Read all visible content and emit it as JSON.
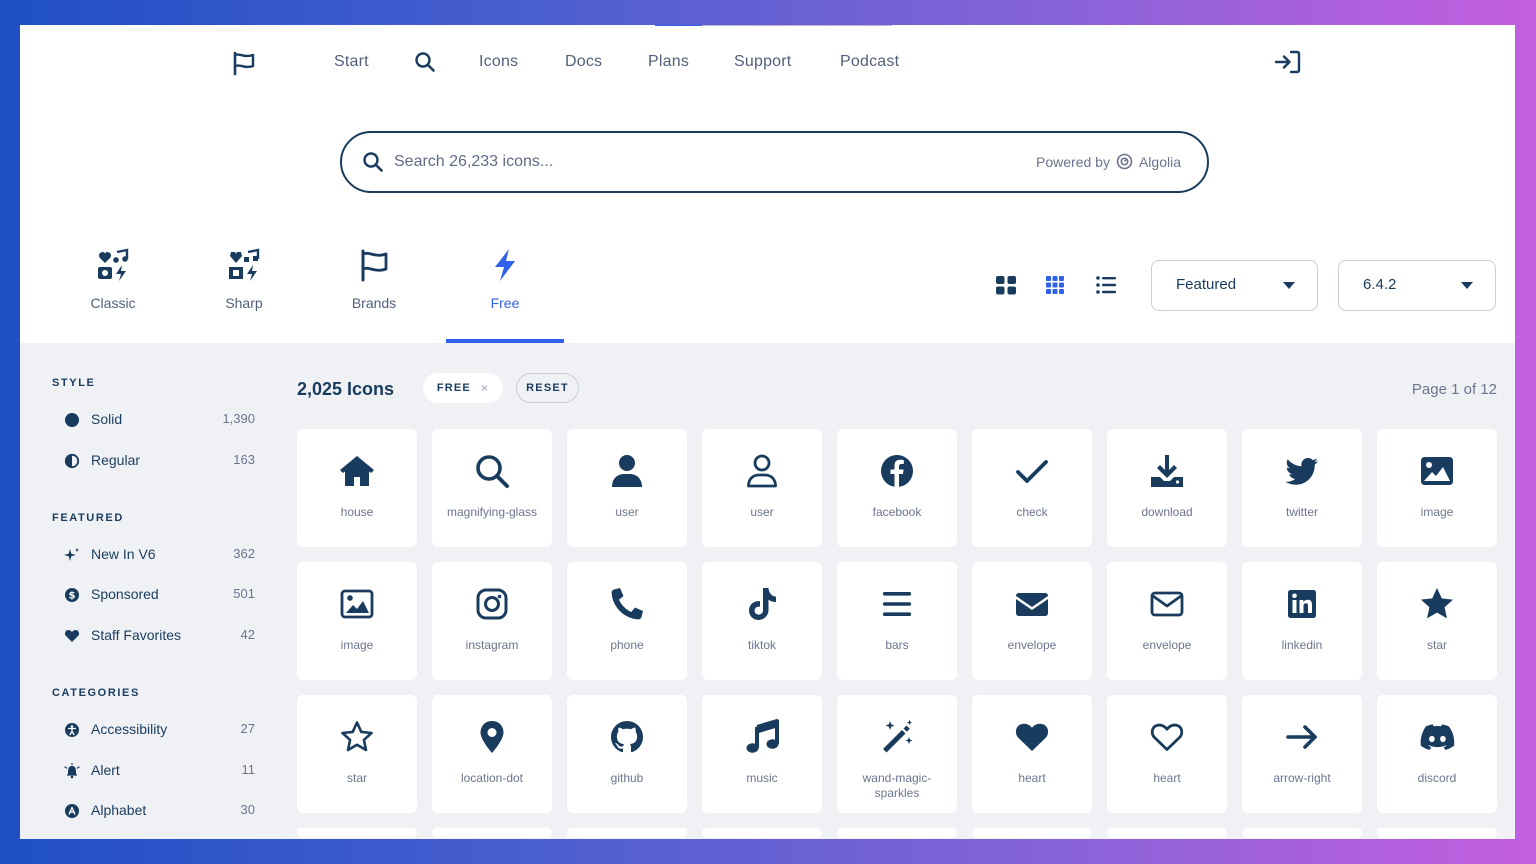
{
  "nav": {
    "links": [
      "Start",
      "Icons",
      "Docs",
      "Plans",
      "Support",
      "Podcast"
    ]
  },
  "search": {
    "placeholder": "Search 26,233 icons...",
    "powered_by": "Powered by",
    "provider": "Algolia"
  },
  "families": [
    {
      "label": "Classic",
      "icon": "classic-family-icon"
    },
    {
      "label": "Sharp",
      "icon": "sharp-family-icon"
    },
    {
      "label": "Brands",
      "icon": "flag-icon"
    },
    {
      "label": "Free",
      "icon": "bolt-icon",
      "active": true
    }
  ],
  "selects": {
    "sort": "Featured",
    "version": "6.4.2"
  },
  "sidebar": {
    "style_heading": "STYLE",
    "style": [
      {
        "label": "Solid",
        "count": "1,390",
        "icon": "solid-circle-icon"
      },
      {
        "label": "Regular",
        "count": "163",
        "icon": "half-circle-icon"
      }
    ],
    "featured_heading": "FEATURED",
    "featured": [
      {
        "label": "New In V6",
        "count": "362",
        "icon": "sparkle-icon"
      },
      {
        "label": "Sponsored",
        "count": "501",
        "icon": "dollar-circle-icon"
      },
      {
        "label": "Staff Favorites",
        "count": "42",
        "icon": "heart-icon"
      }
    ],
    "categories_heading": "CATEGORIES",
    "categories": [
      {
        "label": "Accessibility",
        "count": "27",
        "icon": "accessibility-icon"
      },
      {
        "label": "Alert",
        "count": "11",
        "icon": "bell-alert-icon"
      },
      {
        "label": "Alphabet",
        "count": "30",
        "icon": "alphabet-icon"
      }
    ]
  },
  "results": {
    "title": "2,025 Icons",
    "chip_free": "FREE",
    "chip_close": "×",
    "chip_reset": "RESET",
    "page_info": "Page 1 of 12"
  },
  "icons": [
    "house",
    "magnifying-glass",
    "user",
    "user",
    "facebook",
    "check",
    "download",
    "twitter",
    "image",
    "image",
    "instagram",
    "phone",
    "tiktok",
    "bars",
    "envelope",
    "envelope",
    "linkedin",
    "star",
    "star",
    "location-dot",
    "github",
    "music",
    "wand-magic-sparkles",
    "heart",
    "heart",
    "arrow-right",
    "discord"
  ],
  "colors": {
    "accent": "#2f62e9",
    "navy": "#193c5e",
    "muted": "#515f7a",
    "content_bg": "#f0f1f5"
  }
}
